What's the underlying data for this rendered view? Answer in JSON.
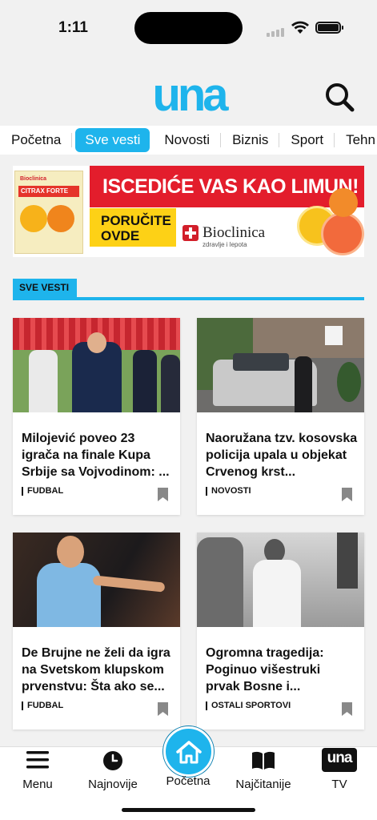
{
  "status_bar": {
    "time": "1:11"
  },
  "header": {
    "logo_text": "una",
    "search_icon": "search-icon"
  },
  "tabs": [
    {
      "label": "Početna"
    },
    {
      "label": "Sve vesti",
      "active": true
    },
    {
      "label": "Novosti"
    },
    {
      "label": "Biznis"
    },
    {
      "label": "Sport"
    },
    {
      "label": "Tehn"
    }
  ],
  "ad": {
    "headline": "ISCEDIĆE VAS KAO LIMUN!",
    "cta_line1": "PORUČITE",
    "cta_line2": "OVDE",
    "brand": "Bioclinica",
    "brand_sub": "zdravlje i lepota",
    "product_brand": "Bioclinica",
    "product_name": "CITRAX FORTE"
  },
  "section": {
    "title": "SVE VESTI"
  },
  "articles": [
    {
      "title": "Milojević poveo 23 igrača na finale Kupa Srbije sa Vojvodinom: ...",
      "category": "FUDBAL"
    },
    {
      "title": "Naoružana tzv. kosovska policija upala u objekat Crvenog krst...",
      "category": "NOVOSTI"
    },
    {
      "title": "De Brujne ne želi da igra na Svetskom klupskom prvenstvu: Šta ako se...",
      "category": "FUDBAL"
    },
    {
      "title": "Ogromna tragedija: Poginuo višestruki prvak Bosne i...",
      "category": "OSTALI SPORTOVI"
    }
  ],
  "bottom_nav": {
    "menu": "Menu",
    "latest": "Najnovije",
    "home": "Početna",
    "most_read": "Najčitanije",
    "tv": "TV",
    "tv_logo": "una"
  },
  "colors": {
    "accent": "#1eb4ec",
    "ad_red": "#e31d2c",
    "ad_yellow": "#fdd116"
  }
}
